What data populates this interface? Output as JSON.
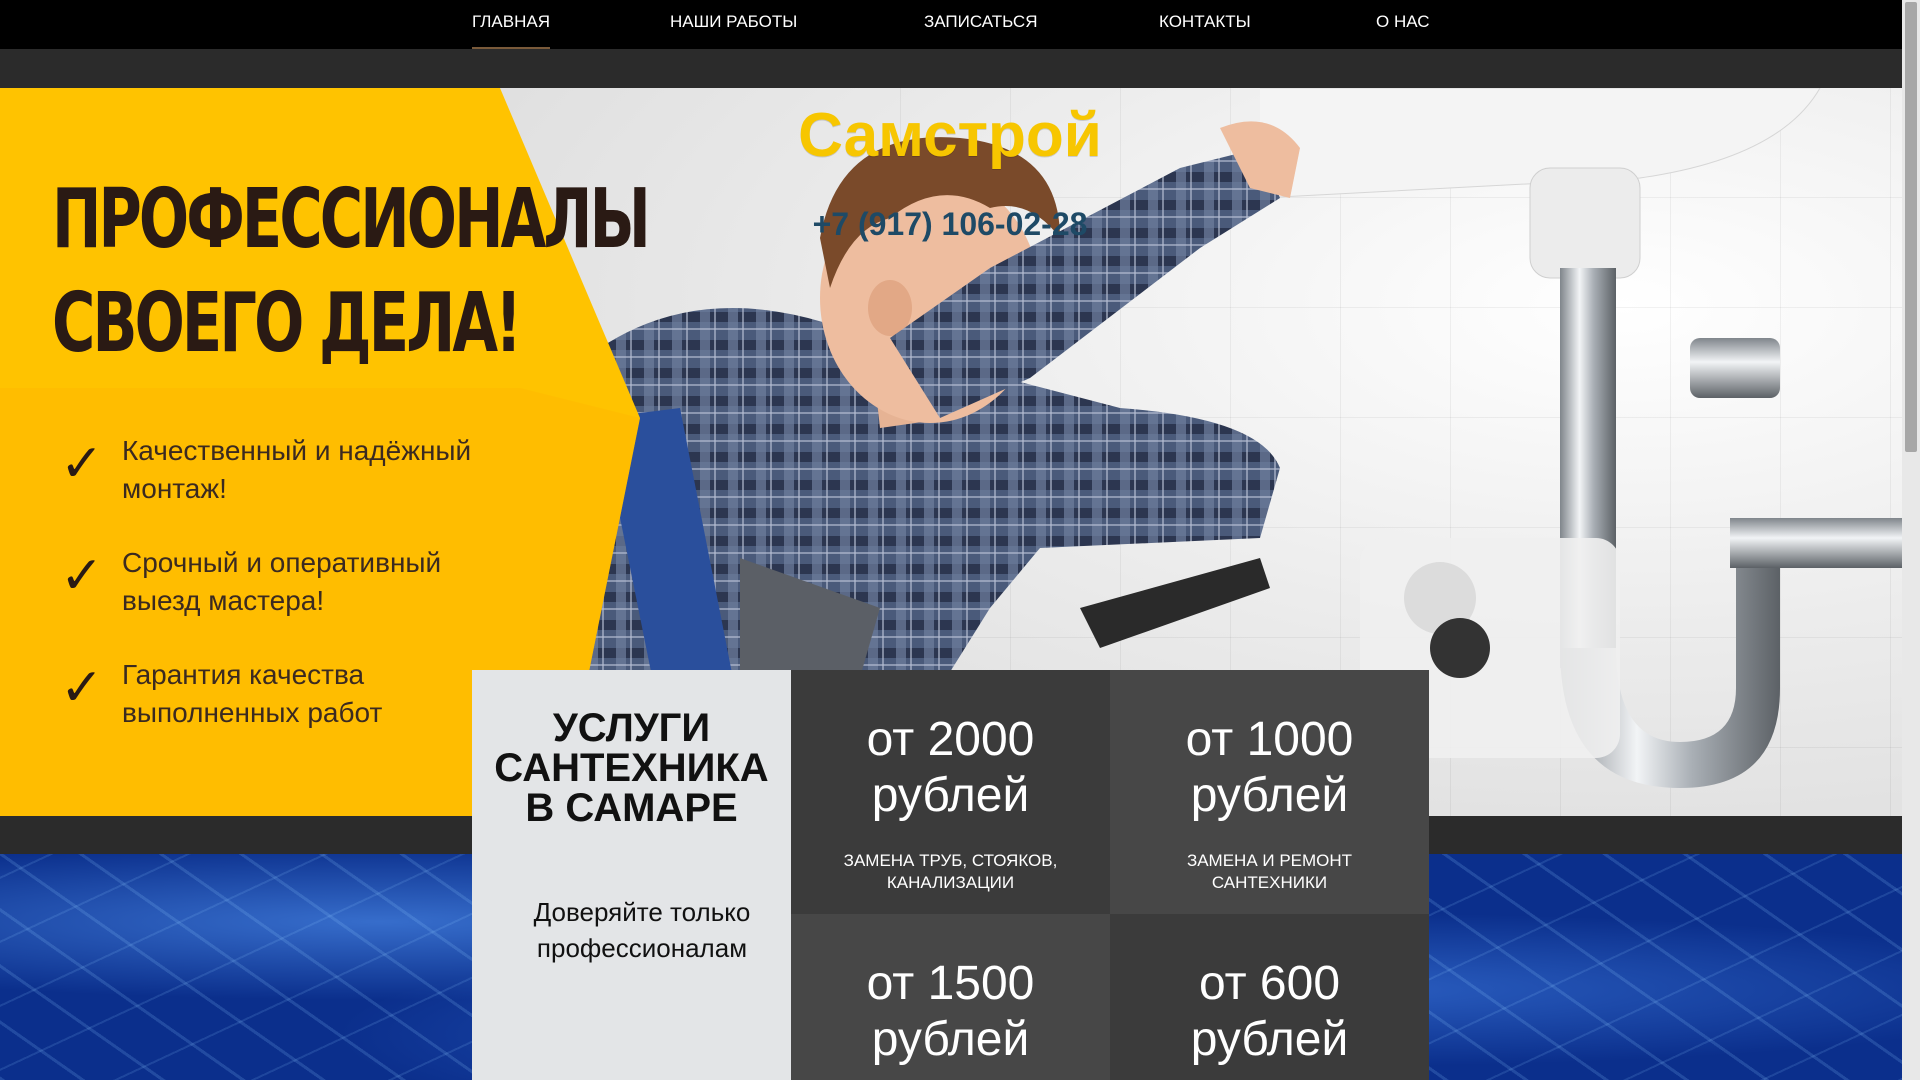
{
  "nav": {
    "items": [
      {
        "label": "ГЛАВНАЯ",
        "active": true
      },
      {
        "label": "НАШИ РАБОТЫ",
        "active": false
      },
      {
        "label": "ЗАПИСАТЬСЯ",
        "active": false
      },
      {
        "label": "КОНТАКТЫ",
        "active": false
      },
      {
        "label": "О НАС",
        "active": false
      }
    ]
  },
  "hero": {
    "headline_line1": "ПРОФЕССИОНАЛЫ",
    "headline_line2": "СВОЕГО ДЕЛА!",
    "bullets": [
      {
        "line1": "Качественный и надёжный",
        "line2": "монтаж!"
      },
      {
        "line1": "Срочный и оперативный",
        "line2": "выезд мастера!"
      },
      {
        "line1": "Гарантия качества",
        "line2": "выполненных работ"
      }
    ],
    "brand": "Самстрой",
    "phone": "+7 (917) 106-02-28"
  },
  "services": {
    "title_line1": "УСЛУГИ",
    "title_line2": "САНТЕХНИКА",
    "title_line3": "В САМАРЕ",
    "subtitle_line1": "Доверяйте только",
    "subtitle_line2": "профессионалам",
    "tiles": [
      {
        "price_line1": "от 2000",
        "price_line2": "рублей",
        "desc_line1": "ЗАМЕНА ТРУБ, СТОЯКОВ,",
        "desc_line2": "КАНАЛИЗАЦИИ"
      },
      {
        "price_line1": "от 1000",
        "price_line2": "рублей",
        "desc_line1": "ЗАМЕНА И РЕМОНТ",
        "desc_line2": "САНТЕХНИКИ"
      },
      {
        "price_line1": "от 1500",
        "price_line2": "рублей",
        "desc_line1": "",
        "desc_line2": ""
      },
      {
        "price_line1": "от 600",
        "price_line2": "рублей",
        "desc_line1": "",
        "desc_line2": ""
      }
    ]
  },
  "colors": {
    "brand_yellow": "#f7c600",
    "panel_yellow": "#ffc300",
    "phone_blue": "#1e4a66",
    "tile_dark": "#3b3b3b",
    "tile_mid": "#474747",
    "nav_bg": "#000000"
  }
}
